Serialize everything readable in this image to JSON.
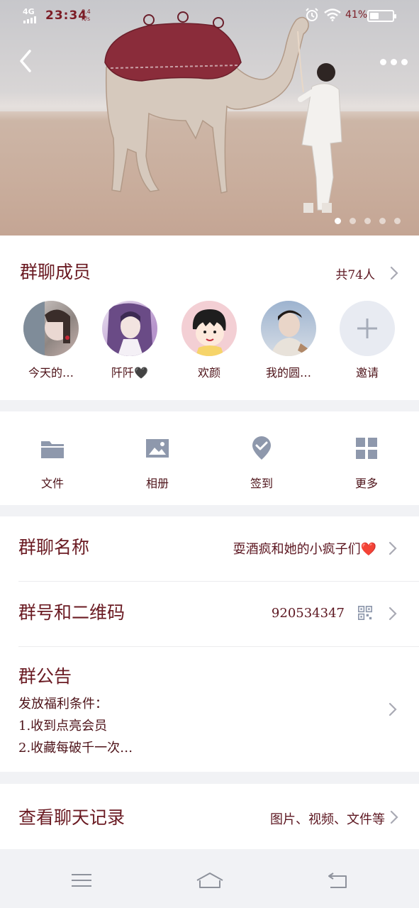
{
  "status_bar": {
    "network": "4G",
    "time": "23:34",
    "speed_value": "0.4",
    "speed_unit": "K/s",
    "battery_percent": "41%",
    "battery_level": 0.41
  },
  "hero": {
    "image_icon": "camel-desert-photo",
    "back_icon": "chevron-left-icon",
    "more_icon": "more-dots-icon",
    "page_count": 5,
    "active_page": 0
  },
  "members": {
    "title": "群聊成员",
    "count_label": "共74人",
    "items": [
      {
        "name": "今天的…",
        "avatar": "avatar-girl-icon"
      },
      {
        "name": "阡阡🖤",
        "avatar": "avatar-anime-icon"
      },
      {
        "name": "欢颜",
        "avatar": "avatar-cartoon-icon"
      },
      {
        "name": "我的圆…",
        "avatar": "avatar-boy-icon"
      }
    ],
    "invite_label": "邀请"
  },
  "tools": [
    {
      "label": "文件",
      "icon": "folder-icon"
    },
    {
      "label": "相册",
      "icon": "image-icon"
    },
    {
      "label": "签到",
      "icon": "check-badge-icon"
    },
    {
      "label": "更多",
      "icon": "grid-icon"
    }
  ],
  "info": {
    "group_name_label": "群聊名称",
    "group_name_value": "耍酒疯和她的小疯子们❤️",
    "group_id_label": "群号和二维码",
    "group_id_value": "920534347",
    "notice_label": "群公告",
    "notice_lines": [
      "发放福利条件：",
      "1.收到点亮会员",
      "2.收藏每破千一次…"
    ]
  },
  "history": {
    "label": "查看聊天记录",
    "value": "图片、视频、文件等"
  },
  "colors": {
    "text": "#6a1a22",
    "icon": "#8e98ac",
    "background": "#f1f2f5",
    "heart": "#d9192d"
  }
}
